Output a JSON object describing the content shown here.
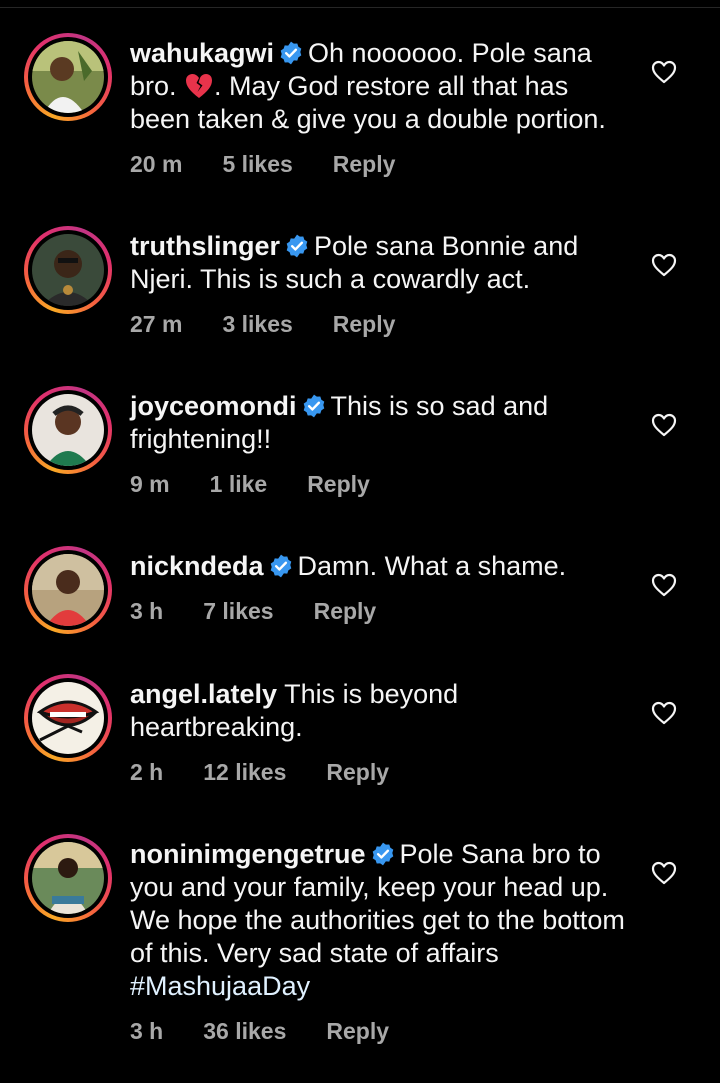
{
  "colors": {
    "background": "#000000",
    "text": "#f5f5f5",
    "meta": "#a8a8a8",
    "verified_badge": "#3897f0"
  },
  "comments": [
    {
      "username": "wahukagwi",
      "verified": true,
      "text_before_emoji": "Oh noooooo. Pole sana bro. ",
      "emoji": "broken-heart-icon",
      "text": ". May God restore all that has been taken &  give you a double portion.",
      "time": "20 m",
      "likes": "5 likes",
      "reply": "Reply"
    },
    {
      "username": "truthslinger",
      "verified": true,
      "text": "Pole sana Bonnie and Njeri. This is such a cowardly act.",
      "time": "27 m",
      "likes": "3 likes",
      "reply": "Reply"
    },
    {
      "username": "joyceomondi",
      "verified": true,
      "text": "This is so sad and frightening!!",
      "time": "9 m",
      "likes": "1 like",
      "reply": "Reply"
    },
    {
      "username": "nickndeda",
      "verified": true,
      "text": "Damn. What a shame.",
      "time": "3 h",
      "likes": "7 likes",
      "reply": "Reply"
    },
    {
      "username": "angel.lately",
      "verified": false,
      "text": "This is beyond heartbreaking.",
      "time": "2 h",
      "likes": "12 likes",
      "reply": "Reply"
    },
    {
      "username": "noninimgengetrue",
      "verified": true,
      "text": "Pole Sana bro to you and your family, keep your head up. We hope the authorities get to the bottom of this. Very sad state of affairs ",
      "hashtag": "#MashujaaDay",
      "time": "3 h",
      "likes": "36 likes",
      "reply": "Reply"
    }
  ]
}
